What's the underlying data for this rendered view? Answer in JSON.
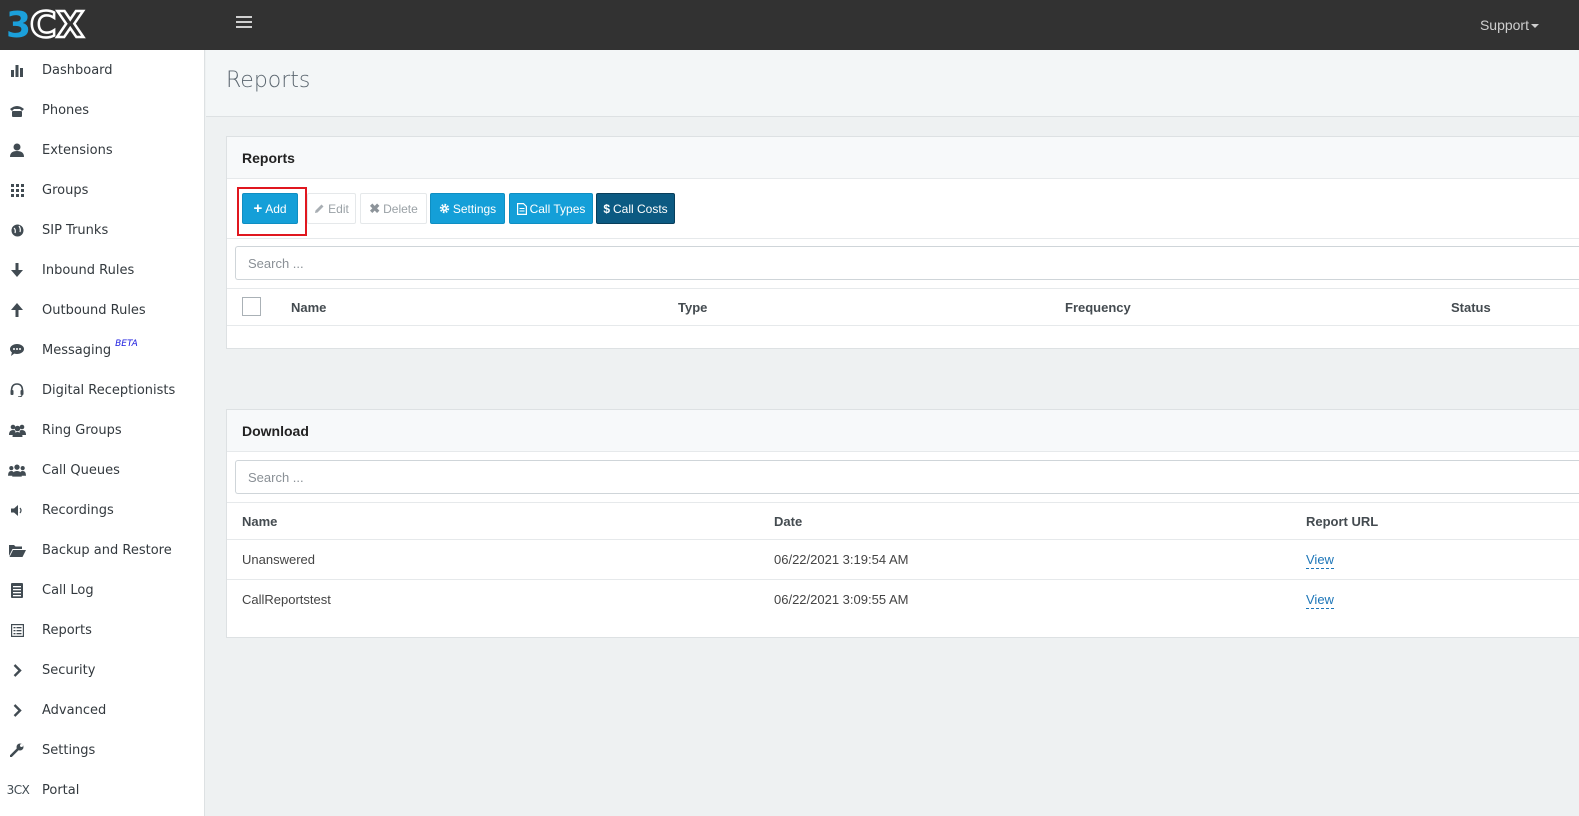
{
  "header": {
    "logo_text": "3CX",
    "support_label": "Support"
  },
  "sidebar": {
    "items": [
      {
        "label": "Dashboard",
        "icon": "bar-chart-icon"
      },
      {
        "label": "Phones",
        "icon": "phone-icon"
      },
      {
        "label": "Extensions",
        "icon": "user-icon"
      },
      {
        "label": "Groups",
        "icon": "grid-icon"
      },
      {
        "label": "SIP Trunks",
        "icon": "globe-icon"
      },
      {
        "label": "Inbound Rules",
        "icon": "arrow-down-icon"
      },
      {
        "label": "Outbound Rules",
        "icon": "arrow-up-icon"
      },
      {
        "label": "Messaging",
        "icon": "chat-icon",
        "badge": "BETA"
      },
      {
        "label": "Digital Receptionists",
        "icon": "headset-icon"
      },
      {
        "label": "Ring Groups",
        "icon": "users-icon"
      },
      {
        "label": "Call Queues",
        "icon": "group-icon"
      },
      {
        "label": "Recordings",
        "icon": "speaker-icon"
      },
      {
        "label": "Backup and Restore",
        "icon": "folder-open-icon"
      },
      {
        "label": "Call Log",
        "icon": "list-icon"
      },
      {
        "label": "Reports",
        "icon": "report-icon"
      },
      {
        "label": "Security",
        "icon": "chevron-right-icon"
      },
      {
        "label": "Advanced",
        "icon": "chevron-right-icon"
      },
      {
        "label": "Settings",
        "icon": "wrench-icon"
      },
      {
        "label": "Portal",
        "icon": "3cx-logo-icon",
        "icon_text": "3CX"
      }
    ]
  },
  "page": {
    "title": "Reports"
  },
  "reports_panel": {
    "heading": "Reports",
    "buttons": {
      "add": "Add",
      "edit": "Edit",
      "delete": "Delete",
      "settings": "Settings",
      "call_types": "Call Types",
      "call_costs": "Call Costs"
    },
    "search_placeholder": "Search ...",
    "columns": [
      "Name",
      "Type",
      "Frequency",
      "Status"
    ]
  },
  "download_panel": {
    "heading": "Download",
    "search_placeholder": "Search ...",
    "columns": [
      "Name",
      "Date",
      "Report URL"
    ],
    "rows": [
      {
        "name": "Unanswered",
        "date": "06/22/2021 3:19:54 AM",
        "url_label": "View"
      },
      {
        "name": "CallReportstest",
        "date": "06/22/2021 3:09:55 AM",
        "url_label": "View"
      }
    ]
  },
  "colors": {
    "topbar": "#323232",
    "primary_button": "#149fd8",
    "dark_button": "#0c5a82",
    "highlight": "#e0171f",
    "link": "#1d76b8",
    "logo_blue": "#1ba0db"
  }
}
